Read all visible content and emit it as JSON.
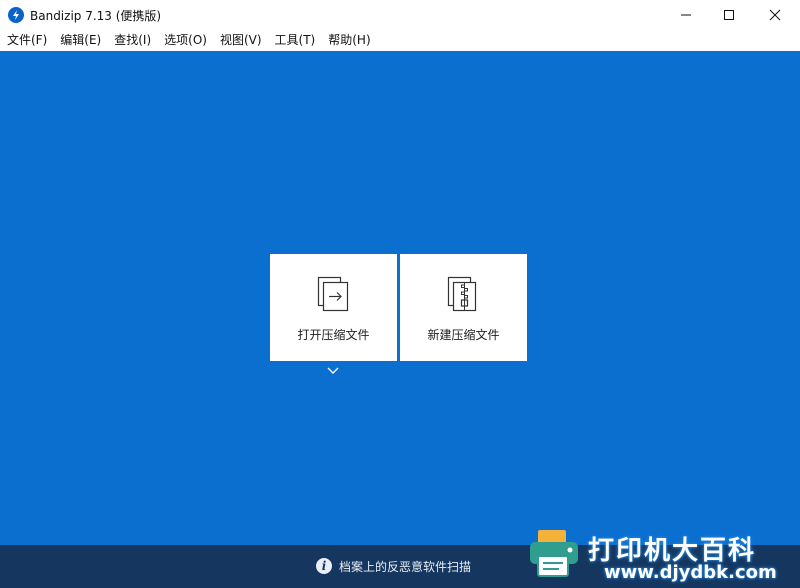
{
  "window": {
    "title": "Bandizip 7.13 (便携版)",
    "minimize_icon": "minimize-icon",
    "maximize_icon": "maximize-icon",
    "close_icon": "close-icon"
  },
  "menu": {
    "items": [
      {
        "label": "文件(F)"
      },
      {
        "label": "编辑(E)"
      },
      {
        "label": "查找(I)"
      },
      {
        "label": "选项(O)"
      },
      {
        "label": "视图(V)"
      },
      {
        "label": "工具(T)"
      },
      {
        "label": "帮助(H)"
      }
    ]
  },
  "main": {
    "open_archive": {
      "label": "打开压缩文件",
      "icon": "open-archive-icon"
    },
    "new_archive": {
      "label": "新建压缩文件",
      "icon": "new-archive-icon"
    },
    "expand_icon": "chevron-down-icon"
  },
  "status": {
    "icon": "info-icon",
    "text": "档案上的反恶意软件扫描"
  },
  "watermark": {
    "brand": "打印机大百科",
    "url": "www.djydbk.com"
  },
  "colors": {
    "main_background": "#0b6fd0",
    "status_background": "#15365f",
    "card_background": "#ffffff",
    "app_icon": "#0a63c9"
  }
}
